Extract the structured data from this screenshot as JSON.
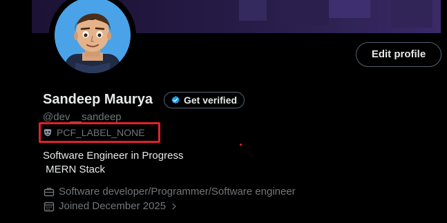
{
  "profile": {
    "name": "Sandeep Maurya",
    "verify_label": "Get verified",
    "handle": "@dev__sandeep",
    "label_text": "PCF_LABEL_NONE",
    "bio_line1": "Software Engineer in Progress",
    "bio_line2": " MERN Stack",
    "profession": "Software developer/Programmer/Software engineer",
    "joined": "Joined December 2025",
    "edit_label": "Edit profile"
  },
  "icons": {
    "verify": "verified-badge-icon",
    "label": "mask-icon",
    "profession": "briefcase-icon",
    "joined": "calendar-icon",
    "joined_chevron": "chevron-right-icon"
  },
  "colors": {
    "background": "#000000",
    "text_primary": "#e7e9ea",
    "text_secondary": "#71767b",
    "border": "#536471",
    "verified_blue": "#1d9bf0",
    "annotation_red": "#e5202b"
  }
}
